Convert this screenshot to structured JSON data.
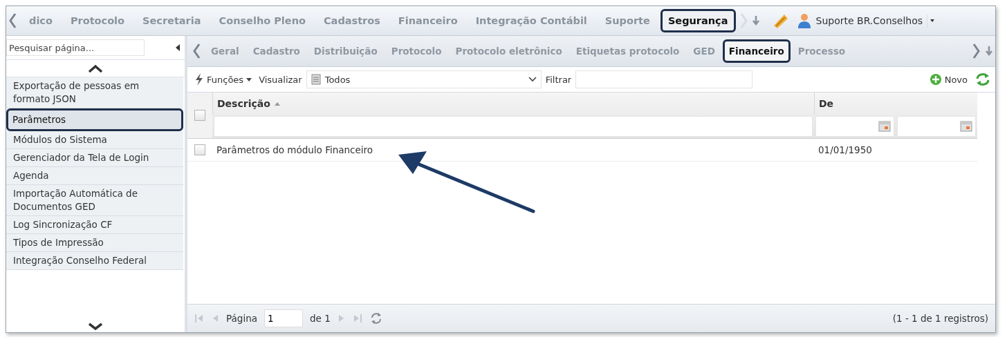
{
  "topbar": {
    "tabs": [
      {
        "label": "dico",
        "selected": false
      },
      {
        "label": "Protocolo",
        "selected": false
      },
      {
        "label": "Secretaria",
        "selected": false
      },
      {
        "label": "Conselho Pleno",
        "selected": false
      },
      {
        "label": "Cadastros",
        "selected": false
      },
      {
        "label": "Financeiro",
        "selected": false
      },
      {
        "label": "Integração Contábil",
        "selected": false
      },
      {
        "label": "Suporte",
        "selected": false
      },
      {
        "label": "Segurança",
        "selected": true
      }
    ],
    "user": "Suporte BR.Conselhos"
  },
  "sidebar": {
    "search": {
      "placeholder": "Pesquisar página..."
    },
    "items": [
      {
        "label": "Exportação de pessoas em formato JSON",
        "selected": false
      },
      {
        "label": "Parâmetros",
        "selected": true
      },
      {
        "label": "Módulos do Sistema",
        "selected": false
      },
      {
        "label": "Gerenciador da Tela de Login",
        "selected": false
      },
      {
        "label": "Agenda",
        "selected": false
      },
      {
        "label": "Importação Automática de Documentos GED",
        "selected": false
      },
      {
        "label": "Log Sincronização CF",
        "selected": false
      },
      {
        "label": "Tipos de Impressão",
        "selected": false
      },
      {
        "label": "Integração Conselho Federal",
        "selected": false
      }
    ]
  },
  "module_tabs": [
    {
      "label": "Geral",
      "selected": false
    },
    {
      "label": "Cadastro",
      "selected": false
    },
    {
      "label": "Distribuição",
      "selected": false
    },
    {
      "label": "Protocolo",
      "selected": false
    },
    {
      "label": "Protocolo eletrônico",
      "selected": false
    },
    {
      "label": "Etiquetas protocolo",
      "selected": false
    },
    {
      "label": "GED",
      "selected": false
    },
    {
      "label": "Financeiro",
      "selected": true
    },
    {
      "label": "Processo",
      "selected": false
    }
  ],
  "toolbar": {
    "functions": "Funções",
    "view_label": "Visualizar",
    "view_value": "Todos",
    "filter_label": "Filtrar",
    "new": "Novo"
  },
  "grid": {
    "all_checked": false,
    "columns": [
      {
        "label": "Descrição",
        "sorted": true
      },
      {
        "label": "De",
        "sorted": false
      }
    ],
    "rows": [
      {
        "checked": false,
        "cells": [
          "Parâmetros do módulo Financeiro",
          "01/01/1950"
        ]
      }
    ]
  },
  "pager": {
    "page_label": "Página",
    "page": "1",
    "of": "de 1",
    "summary": "(1 - 1 de 1 registros)"
  }
}
